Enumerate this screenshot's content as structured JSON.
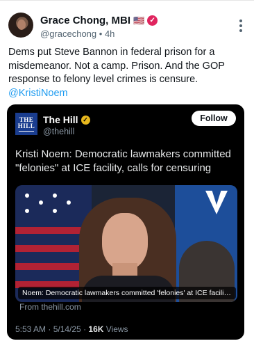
{
  "post": {
    "author_name": "Grace Chong, MBI",
    "author_flag": "🇺🇸",
    "verified_mark": "✓",
    "handle": "@gracechong",
    "separator": "•",
    "time": "4h",
    "text": "Dems put Steve Bannon in federal prison for a misdemeanor. Not a camp. Prison. And the GOP response to felony level crimes is censure.",
    "mention": "@KristiNoem"
  },
  "quoted": {
    "logo_line1": "THE",
    "logo_line2": "HILL",
    "account_name": "The Hill",
    "verified_mark": "✓",
    "handle": "@thehill",
    "follow_label": "Follow",
    "headline": "Kristi Noem: Democratic lawmakers committed \"felonies\" at ICE facility, calls for censuring",
    "image_caption": "Noem: Democratic lawmakers committed 'felonies' at ICE facility, c...",
    "source": "From thehill.com",
    "timestamp": "5:53 AM · 5/14/25 · ",
    "views_count": "16K",
    "views_label": " Views"
  },
  "colors": {
    "accent": "#1d9bf0",
    "verified_pink": "#e0245e",
    "verified_gold": "#e8b81e",
    "card_bg": "#000000"
  },
  "icons": [
    "more-options-icon",
    "verified-badge-icon",
    "us-flag-icon"
  ]
}
